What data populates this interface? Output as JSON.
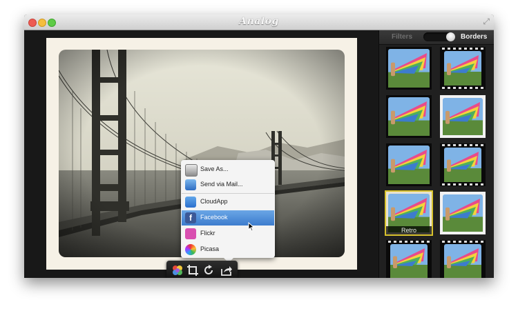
{
  "app": {
    "title": "Analog"
  },
  "sidebar": {
    "tabs": [
      {
        "label": "Filters",
        "selected": false
      },
      {
        "label": "Borders",
        "selected": true
      }
    ],
    "selected_thumbnail_label": "Retro"
  },
  "share_menu": {
    "items": [
      {
        "label": "Save As...",
        "icon": "drive-icon"
      },
      {
        "label": "Send via Mail...",
        "icon": "mail-icon"
      },
      {
        "label": "CloudApp",
        "icon": "cloud-icon"
      },
      {
        "label": "Facebook",
        "icon": "facebook-icon"
      },
      {
        "label": "Flickr",
        "icon": "flickr-icon"
      },
      {
        "label": "Picasa",
        "icon": "picasa-icon"
      }
    ],
    "highlighted": "Facebook"
  },
  "toolbar": {
    "buttons": [
      "filter-wheel-icon",
      "crop-icon",
      "rotate-icon",
      "share-icon"
    ]
  },
  "colors": {
    "highlight": "#3d7ccd",
    "selection_border": "#d8c22c",
    "frame": "#f6f1e6"
  }
}
